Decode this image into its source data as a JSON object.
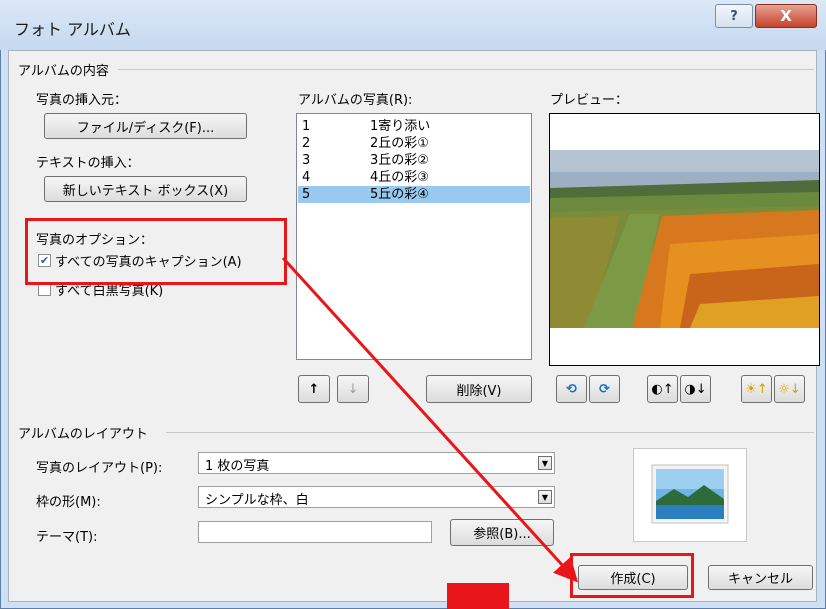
{
  "window": {
    "title": "フォト アルバム",
    "help_label": "?",
    "close_label": "X"
  },
  "album_content": {
    "group_label": "アルバムの内容",
    "insert_from_label": "写真の挿入元：",
    "file_disk_button": "ファイル/ディスク(F)...",
    "insert_text_label": "テキストの挿入：",
    "new_textbox_button": "新しいテキスト ボックス(X)",
    "photo_options_label": "写真のオプション：",
    "captions_checkbox": {
      "label": "すべての写真のキャプション(A)",
      "checked": true
    },
    "bw_checkbox": {
      "label": "すべて白黒写真(K)",
      "checked": false
    }
  },
  "album_photos": {
    "label": "アルバムの写真(R):",
    "items": [
      {
        "num": "1",
        "name": "1寄り添い"
      },
      {
        "num": "2",
        "name": "2丘の彩①"
      },
      {
        "num": "3",
        "name": "3丘の彩②"
      },
      {
        "num": "4",
        "name": "4丘の彩③"
      },
      {
        "num": "5",
        "name": "5丘の彩④"
      }
    ],
    "selected_index": 4,
    "up_icon": "↑",
    "down_icon": "↓",
    "delete_button": "削除(V)"
  },
  "preview": {
    "label": "プレビュー："
  },
  "image_tools": {
    "icons": [
      "rotate-left-icon",
      "rotate-right-icon",
      "contrast-up-icon",
      "contrast-down-icon",
      "brightness-up-icon",
      "brightness-down-icon"
    ]
  },
  "layout": {
    "group_label": "アルバムのレイアウト",
    "picture_layout_label": "写真のレイアウト(P):",
    "picture_layout_value": "1 枚の写真",
    "frame_label": "枠の形(M):",
    "frame_value": "シンプルな枠、白",
    "theme_label": "テーマ(T):",
    "theme_value": "",
    "browse_button": "参照(B)..."
  },
  "footer": {
    "create_button": "作成(C)",
    "cancel_button": "キャンセル"
  },
  "colors": {
    "annotation_red": "#e8161a",
    "selection": "#99c9ef"
  }
}
